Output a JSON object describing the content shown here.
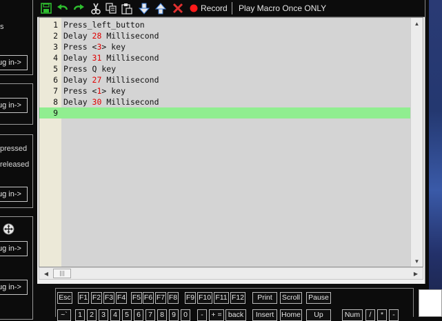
{
  "left_panel": {
    "fragment_s": "s",
    "plugin_label": "ug in->",
    "pressed": "pressed",
    "released": "released"
  },
  "toolbar": {
    "record_label": "Record",
    "play_label": "Play Macro Once ONLY"
  },
  "editor": {
    "lines": [
      {
        "n": "1",
        "pre": "Press_left_button",
        "num": "",
        "post": ""
      },
      {
        "n": "2",
        "pre": "Delay ",
        "num": "28",
        "post": " Millisecond"
      },
      {
        "n": "3",
        "pre": "Press <",
        "num": "3",
        "post": "> key"
      },
      {
        "n": "4",
        "pre": "Delay ",
        "num": "31",
        "post": " Millisecond"
      },
      {
        "n": "5",
        "pre": "Press Q key",
        "num": "",
        "post": ""
      },
      {
        "n": "6",
        "pre": "Delay ",
        "num": "27",
        "post": " Millisecond"
      },
      {
        "n": "7",
        "pre": "Press <",
        "num": "1",
        "post": "> key"
      },
      {
        "n": "8",
        "pre": "Delay ",
        "num": "30",
        "post": " Millisecond"
      },
      {
        "n": "9",
        "pre": "",
        "num": "",
        "post": ""
      }
    ],
    "hscroll_thumb": "|||"
  },
  "keyboard": {
    "row1": [
      "Esc",
      "F1",
      "F2",
      "F3",
      "F4",
      "F5",
      "F6",
      "F7",
      "F8",
      "F9",
      "F10",
      "F11",
      "F12",
      "Print",
      "Scroll",
      "Pause"
    ],
    "row2": [
      "~`",
      "1",
      "2",
      "3",
      "4",
      "5",
      "6",
      "7",
      "8",
      "9",
      "0",
      "-",
      "+ =",
      "back",
      "Insert",
      "Home",
      "Up",
      "Num",
      "/",
      "*",
      "-"
    ]
  },
  "colors": {
    "background": "#0c0c0c",
    "editor_bg": "#d4d4d4",
    "active_line": "#90ee90",
    "number_red": "#e00000",
    "gutter": "#ece9d8"
  }
}
